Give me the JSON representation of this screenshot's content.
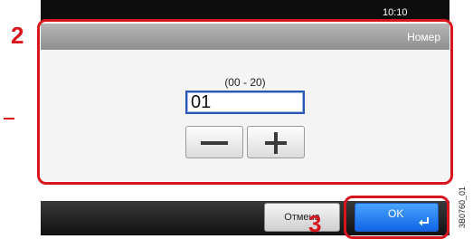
{
  "status": {
    "clock": "10:10"
  },
  "dialog": {
    "title": "Номер",
    "range_hint": "(00 - 20)",
    "value": "01",
    "decrement_icon": "minus-icon",
    "increment_icon": "plus-icon"
  },
  "footer": {
    "cancel_label": "Отмена",
    "ok_label": "OK",
    "ok_icon": "enter-icon"
  },
  "annotations": {
    "step_2": "2",
    "step_3": "3",
    "highlight_color": "#d8141d",
    "figure_code": "3B0760_01"
  }
}
